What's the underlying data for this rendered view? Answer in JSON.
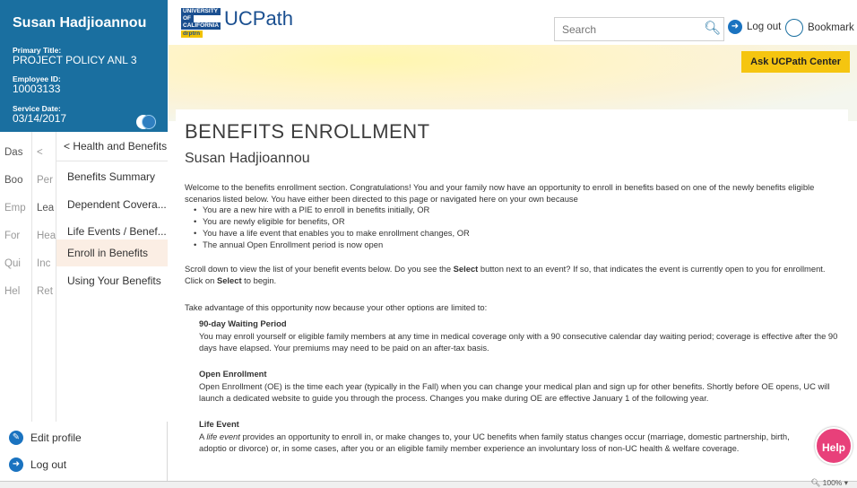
{
  "profile": {
    "name": "Susan Hadjioannou",
    "primary_title_label": "Primary Title:",
    "primary_title": "PROJECT POLICY ANL 3",
    "employee_id_label": "Employee ID:",
    "employee_id": "10003133",
    "service_date_label": "Service Date:",
    "service_date": "03/14/2017"
  },
  "nav_col1": [
    "Das",
    "Boo",
    "Emp",
    "For",
    "Qui",
    "Hel"
  ],
  "nav_col2": [
    "<",
    "Per",
    "Lea",
    "Hea",
    "Inc",
    "Ret"
  ],
  "nav_panel": {
    "back_label": "<  Health and Benefits",
    "items": [
      "Benefits Summary",
      "Dependent Covera...",
      "Life Events / Benef...",
      "Enroll in Benefits",
      "Using Your Benefits"
    ]
  },
  "sidebar_footer": {
    "edit_profile": "Edit profile",
    "log_out": "Log out"
  },
  "header": {
    "logo_line1": "UNIVERSITY",
    "logo_line2": "OF",
    "logo_line3": "CALIFORNIA",
    "logo_tag": "drptrn",
    "app_title": "UCPath",
    "search_placeholder": "Search",
    "log_out": "Log out",
    "bookmark": "Bookmark"
  },
  "ask_button": "Ask UCPath Center",
  "content": {
    "title": "BENEFITS ENROLLMENT",
    "subtitle": "Susan Hadjioannou",
    "intro": "Welcome to the benefits enrollment section. Congratulations! You and your family now have an opportunity to enroll in benefits based on one of the newly benefits eligible scenarios listed below. You have either been directed to this page or navigated here on your own because",
    "bullets": [
      "You are a new hire with a PIE to enroll in benefits initially, OR",
      "You are newly eligible for benefits, OR",
      "You have a life event that enables you to make enrollment changes, OR",
      "The annual Open Enrollment period is now open"
    ],
    "scroll_pre": "Scroll down to view the list of your benefit events below. Do you see the ",
    "scroll_select1": "Select",
    "scroll_mid": " button next to an event? If so, that indicates the event is currently open to you for enrollment. Click on ",
    "scroll_select2": "Select",
    "scroll_post": " to begin.",
    "advantage": "Take advantage of this opportunity now because your other options are limited to:",
    "sections": [
      {
        "heading": "90-day Waiting Period",
        "text": "You may enroll yourself or eligible family members at any time in medical coverage only with a 90 consecutive calendar day waiting period; coverage is effective after the 90 days have elapsed. Your premiums may need to be paid on an after-tax basis."
      },
      {
        "heading": "Open Enrollment",
        "text": "Open Enrollment (OE) is the time each year (typically in the Fall) when you can change your medical plan and sign up for other benefits. Shortly before OE opens, UC will launch a dedicated website to guide you through the process. Changes you make during OE are effective January 1 of the following year."
      }
    ],
    "life_event_heading": "Life Event",
    "life_event_pre": "A ",
    "life_event_italic": "life event",
    "life_event_post": " provides an opportunity to enroll in, or make changes to, your UC benefits when family status changes occur (marriage, domestic partnership, birth, adoptio or divorce) or, in some cases, after you or an eligible family member experience an involuntary loss of non-UC health & welfare coverage."
  },
  "help_label": "Help",
  "zoom_level": "100%",
  "colors": {
    "sidebar_blue": "#1a6fa0",
    "accent_yellow": "#f5c510",
    "help_pink": "#e8407a",
    "active_item": "#fbeee4"
  }
}
